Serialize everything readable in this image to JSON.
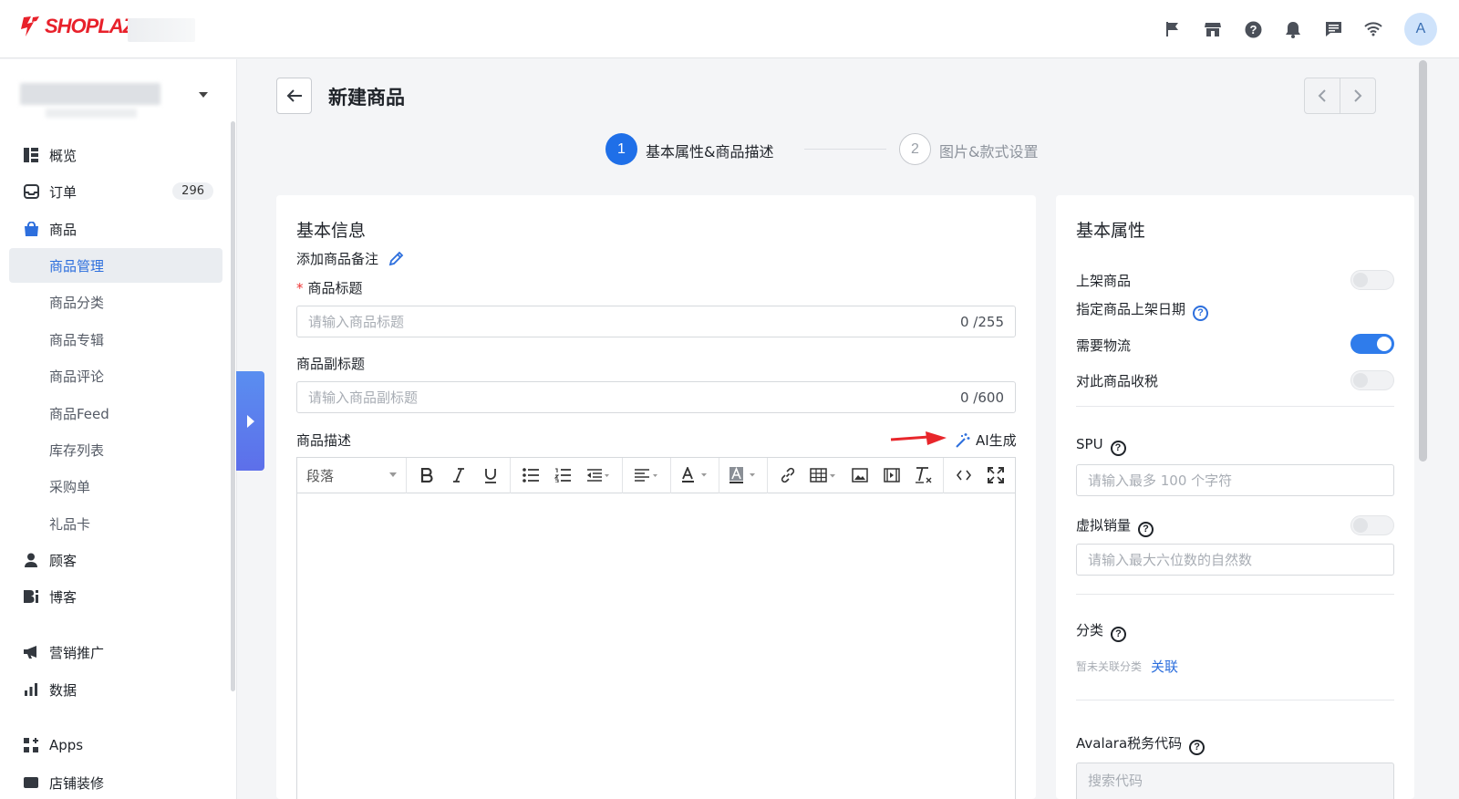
{
  "app": {
    "brand": "SHOPLAZZA",
    "brand_color": "#e8212b",
    "accent_color": "#1f6fe8"
  },
  "topbar": {
    "icons": [
      "flag-icon",
      "store-icon",
      "help-icon",
      "bell-icon",
      "chat-icon",
      "wifi-icon"
    ],
    "avatar_initial": "A"
  },
  "sidebar": {
    "items": [
      {
        "label": "概览",
        "icon": "dashboard-icon"
      },
      {
        "label": "订单",
        "icon": "inbox-icon",
        "badge": "296"
      },
      {
        "label": "商品",
        "icon": "bag-icon",
        "active": true
      },
      {
        "label": "顾客",
        "icon": "person-icon"
      },
      {
        "label": "博客",
        "icon": "blog-icon"
      },
      {
        "label": "营销推广",
        "icon": "megaphone-icon"
      },
      {
        "label": "数据",
        "icon": "bar-chart-icon"
      },
      {
        "label": "Apps",
        "icon": "apps-icon"
      },
      {
        "label": "店铺装修",
        "icon": "store-design-icon"
      }
    ],
    "subitems": [
      {
        "label": "商品管理",
        "active": true
      },
      {
        "label": "商品分类"
      },
      {
        "label": "商品专辑"
      },
      {
        "label": "商品评论"
      },
      {
        "label": "商品Feed"
      },
      {
        "label": "库存列表"
      },
      {
        "label": "采购单"
      },
      {
        "label": "礼品卡"
      }
    ]
  },
  "page": {
    "title": "新建商品",
    "steps": [
      {
        "number": "1",
        "label": "基本属性&商品描述",
        "active": true
      },
      {
        "number": "2",
        "label": "图片&款式设置",
        "active": false
      }
    ]
  },
  "basic_info": {
    "heading": "基本信息",
    "add_note_link": "添加商品备注",
    "title_label": "商品标题",
    "title_required_mark": "*",
    "title_placeholder": "请输入商品标题",
    "title_count": "0 /255",
    "subtitle_label": "商品副标题",
    "subtitle_placeholder": "请输入商品副标题",
    "subtitle_count": "0 /600",
    "description_label": "商品描述",
    "ai_generate": "AI生成",
    "editor_paragraph": "段落",
    "editor_tools": [
      "bold",
      "italic",
      "underline",
      "bulleted-list",
      "numbered-list",
      "indent",
      "align",
      "font-color",
      "background-color",
      "link",
      "table",
      "image",
      "video",
      "clear-format",
      "source-code",
      "fullscreen"
    ]
  },
  "attributes": {
    "heading": "基本属性",
    "publish_label": "上架商品",
    "publish_on": false,
    "publish_date_link": "指定商品上架日期",
    "shipping_label": "需要物流",
    "shipping_on": true,
    "tax_label": "对此商品收税",
    "tax_on": false,
    "spu_label": "SPU",
    "spu_placeholder": "请输入最多 100 个字符",
    "virtual_sales_label": "虚拟销量",
    "virtual_sales_on": false,
    "virtual_sales_placeholder": "请输入最大六位数的自然数",
    "category_label": "分类",
    "category_none_text": "暂未关联分类",
    "category_link": "关联",
    "avalara_label": "Avalara税务代码",
    "avalara_placeholder": "搜索代码"
  }
}
